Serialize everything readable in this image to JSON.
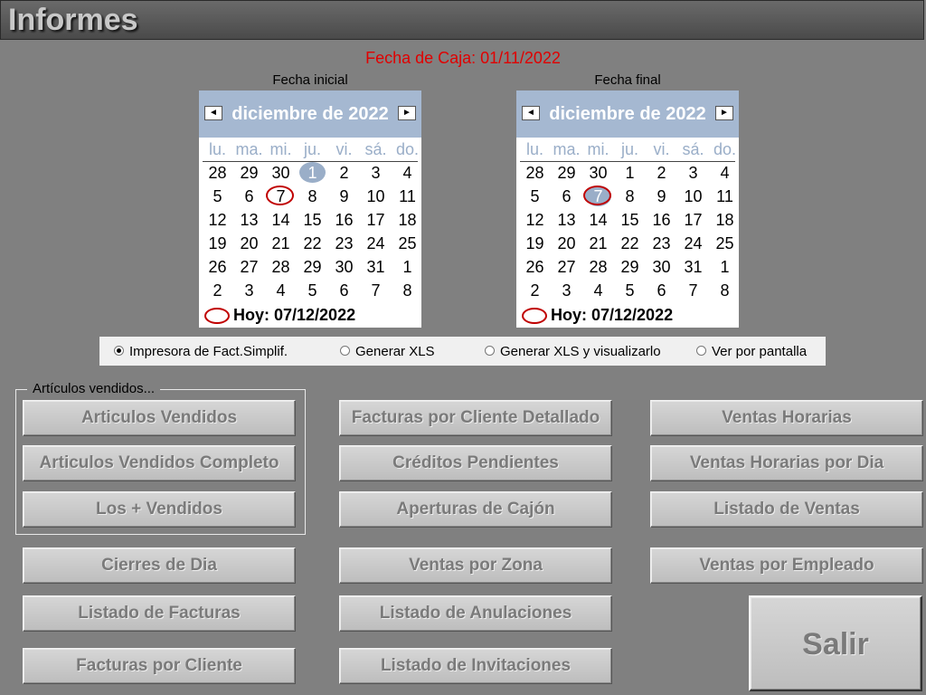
{
  "window": {
    "title": "Informes"
  },
  "fecha_caja": "Fecha de Caja: 01/11/2022",
  "calendars": {
    "inicial": {
      "label": "Fecha inicial",
      "month": "diciembre de 2022",
      "prev": "◄",
      "next": "►",
      "dow": [
        "lu.",
        "ma.",
        "mi.",
        "ju.",
        "vi.",
        "sá.",
        "do."
      ],
      "weeks": [
        [
          "28",
          "29",
          "30",
          "1",
          "2",
          "3",
          "4"
        ],
        [
          "5",
          "6",
          "7",
          "8",
          "9",
          "10",
          "11"
        ],
        [
          "12",
          "13",
          "14",
          "15",
          "16",
          "17",
          "18"
        ],
        [
          "19",
          "20",
          "21",
          "22",
          "23",
          "24",
          "25"
        ],
        [
          "26",
          "27",
          "28",
          "29",
          "30",
          "31",
          "1"
        ],
        [
          "2",
          "3",
          "4",
          "5",
          "6",
          "7",
          "8"
        ]
      ],
      "selected": "1",
      "today": "7",
      "today_label": "Hoy: 07/12/2022"
    },
    "final": {
      "label": "Fecha final",
      "month": "diciembre de 2022",
      "prev": "◄",
      "next": "►",
      "dow": [
        "lu.",
        "ma.",
        "mi.",
        "ju.",
        "vi.",
        "sá.",
        "do."
      ],
      "weeks": [
        [
          "28",
          "29",
          "30",
          "1",
          "2",
          "3",
          "4"
        ],
        [
          "5",
          "6",
          "7",
          "8",
          "9",
          "10",
          "11"
        ],
        [
          "12",
          "13",
          "14",
          "15",
          "16",
          "17",
          "18"
        ],
        [
          "19",
          "20",
          "21",
          "22",
          "23",
          "24",
          "25"
        ],
        [
          "26",
          "27",
          "28",
          "29",
          "30",
          "31",
          "1"
        ],
        [
          "2",
          "3",
          "4",
          "5",
          "6",
          "7",
          "8"
        ]
      ],
      "selected": "7",
      "today": "7",
      "today_label": "Hoy: 07/12/2022"
    }
  },
  "output_options": {
    "selected": "impresora",
    "items": [
      {
        "id": "impresora",
        "label": "Impresora de Fact.Simplif."
      },
      {
        "id": "xls",
        "label": "Generar XLS"
      },
      {
        "id": "xls_ver",
        "label": "Generar XLS y visualizarlo"
      },
      {
        "id": "pantalla",
        "label": "Ver por pantalla"
      }
    ]
  },
  "group_articulos": {
    "legend": "Artículos vendidos..."
  },
  "buttons": {
    "articulos_vendidos": "Articulos Vendidos",
    "articulos_vendidos_completo": "Articulos Vendidos Completo",
    "los_mas_vendidos": "Los + Vendidos",
    "cierres_dia": "Cierres de Dia",
    "listado_facturas": "Listado de Facturas",
    "facturas_cliente": "Facturas por Cliente",
    "facturas_cliente_detallado": "Facturas por Cliente Detallado",
    "creditos_pendientes": "Créditos Pendientes",
    "aperturas_cajon": "Aperturas de Cajón",
    "ventas_zona": "Ventas por Zona",
    "listado_anulaciones": "Listado de Anulaciones",
    "listado_invitaciones": "Listado de Invitaciones",
    "ventas_horarias": "Ventas Horarias",
    "ventas_horarias_dia": "Ventas Horarias por Dia",
    "listado_ventas": "Listado de Ventas",
    "ventas_empleado": "Ventas por Empleado",
    "salir": "Salir"
  }
}
